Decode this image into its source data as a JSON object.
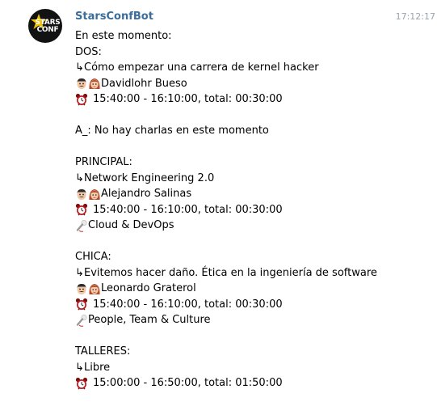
{
  "bot": {
    "name": "StarsConfBot",
    "time": "17:12:17",
    "avatar_text_1": "STARS",
    "avatar_text_2": "CONF",
    "accent_color": "#3a6d99"
  },
  "message": {
    "intro": "En este momento:",
    "sections": [
      {
        "room": "DOS:",
        "title": "Cómo empezar una carrera de kernel hacker",
        "speaker": "Davidlohr Bueso",
        "schedule": "15:40:00 - 16:10:00, total: 00:30:00",
        "track": null
      },
      {
        "room_line": "A_: No hay charlas en este momento"
      },
      {
        "room": "PRINCIPAL:",
        "title": "Network Engineering 2.0",
        "speaker": "Alejandro Salinas",
        "schedule": "15:40:00 - 16:10:00, total: 00:30:00",
        "track": "Cloud & DevOps"
      },
      {
        "room": "CHICA:",
        "title": "Evitemos hacer daño. Ética en la ingeniería de software",
        "speaker": "Leonardo Graterol",
        "schedule": "15:40:00 - 16:10:00, total: 00:30:00",
        "track": "People, Team & Culture"
      },
      {
        "room": "TALLERES:",
        "title": "Libre",
        "speaker": null,
        "schedule": "15:00:00 - 16:50:00, total: 01:50:00",
        "track": null
      }
    ],
    "arrow_glyph": "↳"
  },
  "icons": {
    "speaker": "man-woman-faces-icon",
    "schedule": "alarm-clock-icon",
    "track": "microphone-icon"
  }
}
